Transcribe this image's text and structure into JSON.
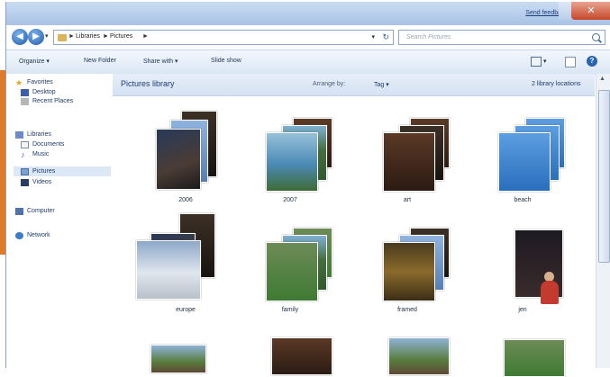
{
  "title_bar": {
    "feedback_link": "Send feedback",
    "close_glyph": "✕"
  },
  "navigation": {
    "back_glyph": "◀",
    "forward_glyph": "▶",
    "address": {
      "segments": [
        "Libraries",
        "Pictures"
      ],
      "separator": "►",
      "dropdown_glyph": "▾",
      "refresh_glyph": "↻"
    },
    "search": {
      "placeholder": "Search Pictures"
    }
  },
  "toolbar": {
    "organize": "Organize ▾",
    "new_folder": "New Folder",
    "share_with": "Share with ▾",
    "slide_show": "Slide show",
    "view_drop": "▾",
    "help": "?"
  },
  "sidebar": {
    "favorites": {
      "label": "Favorites",
      "items": [
        "Desktop",
        "Recent Places"
      ]
    },
    "libraries": {
      "label": "Libraries",
      "items": [
        "Documents",
        "Music",
        "Pictures",
        "Videos"
      ]
    },
    "computer": "Computer",
    "network": "Network",
    "selected": "Pictures"
  },
  "library_header": {
    "title": "Pictures library",
    "arrange_by_label": "Arrange by:",
    "arrange_by_value": "Tag ▾",
    "locations": "2 library locations"
  },
  "folders": [
    {
      "name": "2006",
      "colors": [
        "c-dark",
        "c-sky",
        "c-night"
      ]
    },
    {
      "name": "2007",
      "colors": [
        "c-party",
        "c-green",
        "c-team"
      ]
    },
    {
      "name": "art",
      "colors": [
        "c-party",
        "c-dark",
        "c-party"
      ]
    },
    {
      "name": "beach",
      "colors": [
        "c-blue",
        "c-blue",
        "c-blue"
      ]
    },
    {
      "name": "europe",
      "colors": [
        "c-dark",
        "c-night",
        "c-snow"
      ]
    },
    {
      "name": "family",
      "colors": [
        "c-lawn",
        "c-green",
        "c-lawn"
      ]
    },
    {
      "name": "framed",
      "colors": [
        "c-dark",
        "c-sky",
        "c-framed"
      ]
    },
    {
      "name": "jen",
      "colors": [
        "c-jen"
      ]
    }
  ],
  "scrollbar": {
    "up_glyph": "▲"
  }
}
